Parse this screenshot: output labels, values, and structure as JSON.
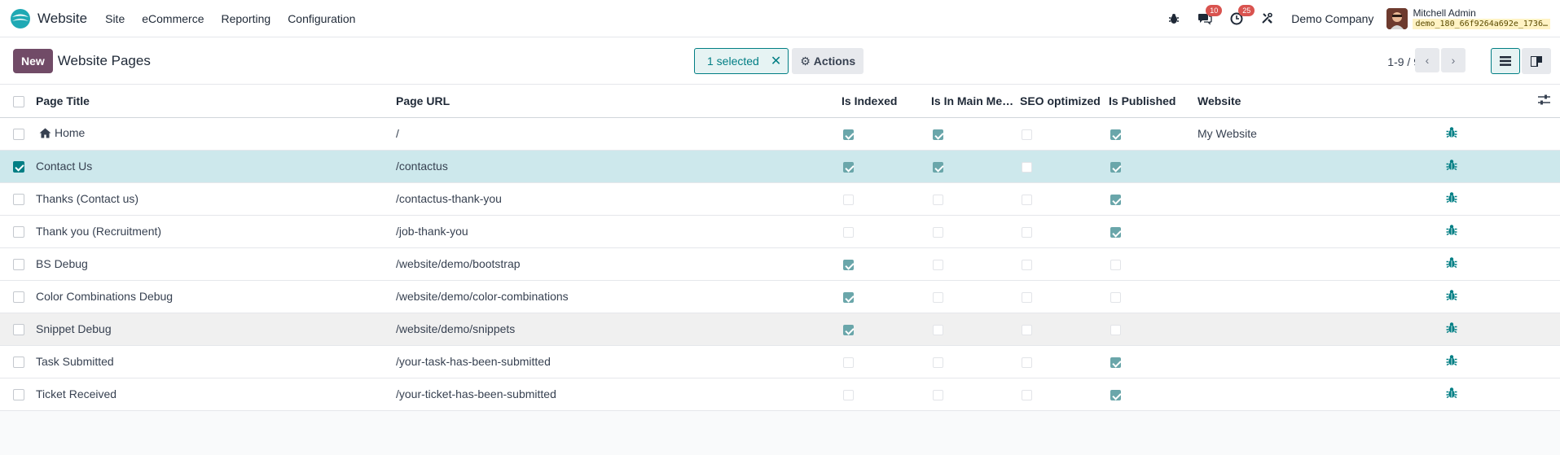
{
  "topbar": {
    "app_name": "Website",
    "menu": [
      "Site",
      "eCommerce",
      "Reporting",
      "Configuration"
    ],
    "messages_count": "10",
    "activities_count": "25",
    "company": "Demo Company",
    "user_name": "Mitchell Admin",
    "db_name": "demo_180_66f9264a692e_1736…"
  },
  "control": {
    "new_label": "New",
    "title": "Website Pages",
    "selected_label": "1 selected",
    "actions_label": "Actions",
    "pager": "1-9 / 9"
  },
  "columns": {
    "page_title": "Page Title",
    "page_url": "Page URL",
    "is_indexed": "Is Indexed",
    "is_in_main_menu": "Is In Main Me…",
    "seo_optimized": "SEO optimized",
    "is_published": "Is Published",
    "website": "Website"
  },
  "rows": [
    {
      "title": "Home",
      "url": "/",
      "indexed": true,
      "main_menu": true,
      "seo": false,
      "published": true,
      "website": "My Website",
      "selected": false,
      "home": true
    },
    {
      "title": "Contact Us",
      "url": "/contactus",
      "indexed": true,
      "main_menu": true,
      "seo": false,
      "published": true,
      "website": "",
      "selected": true
    },
    {
      "title": "Thanks (Contact us)",
      "url": "/contactus-thank-you",
      "indexed": false,
      "main_menu": false,
      "seo": false,
      "published": true,
      "website": "",
      "selected": false
    },
    {
      "title": "Thank you (Recruitment)",
      "url": "/job-thank-you",
      "indexed": false,
      "main_menu": false,
      "seo": false,
      "published": true,
      "website": "",
      "selected": false
    },
    {
      "title": "BS Debug",
      "url": "/website/demo/bootstrap",
      "indexed": true,
      "main_menu": false,
      "seo": false,
      "published": false,
      "website": "",
      "selected": false
    },
    {
      "title": "Color Combinations Debug",
      "url": "/website/demo/color-combinations",
      "indexed": true,
      "main_menu": false,
      "seo": false,
      "published": false,
      "website": "",
      "selected": false
    },
    {
      "title": "Snippet Debug",
      "url": "/website/demo/snippets",
      "indexed": true,
      "main_menu": false,
      "seo": false,
      "published": false,
      "website": "",
      "selected": false,
      "hover": true
    },
    {
      "title": "Task Submitted",
      "url": "/your-task-has-been-submitted",
      "indexed": false,
      "main_menu": false,
      "seo": false,
      "published": true,
      "website": "",
      "selected": false
    },
    {
      "title": "Ticket Received",
      "url": "/your-ticket-has-been-submitted",
      "indexed": false,
      "main_menu": false,
      "seo": false,
      "published": true,
      "website": "",
      "selected": false
    }
  ]
}
